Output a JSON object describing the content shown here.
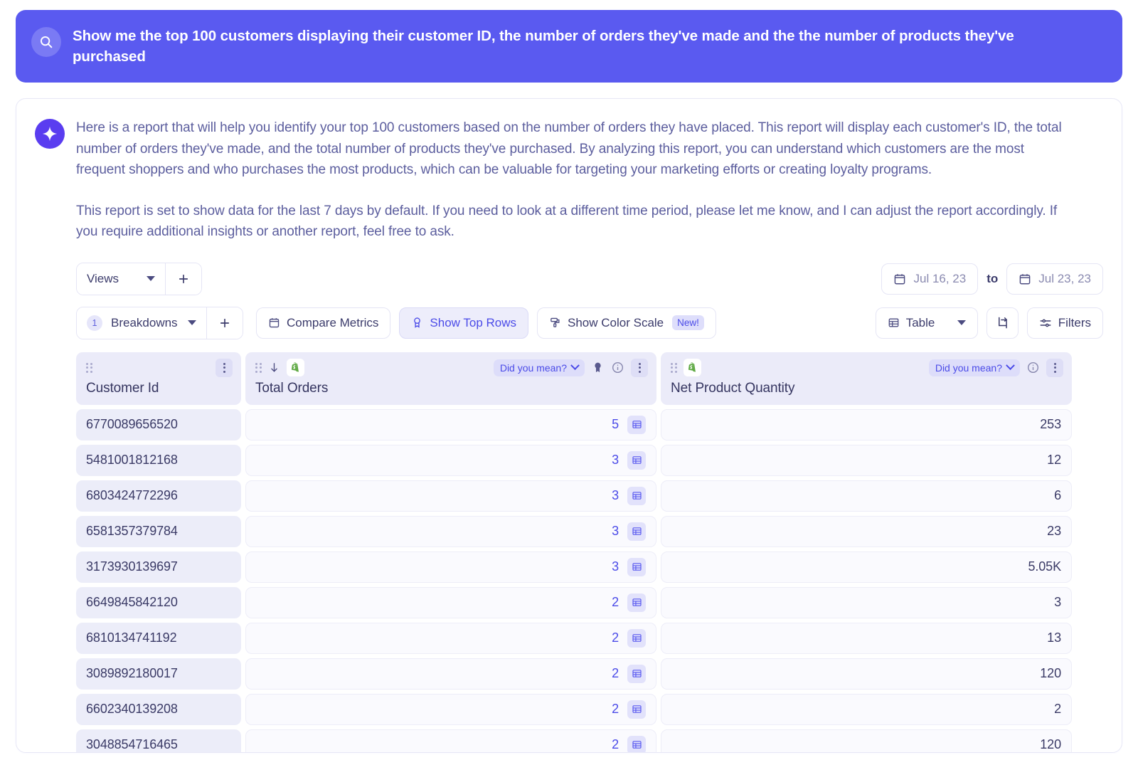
{
  "query": {
    "icon": "search-icon",
    "text": "Show me the top 100 customers displaying their customer ID, the number of orders they've made and the the number of products they've purchased"
  },
  "answer": {
    "icon": "sparkle-icon",
    "paragraph1": "Here is a report that will help you identify your top 100 customers based on the number of orders they have placed. This report will display each customer's ID, the total number of orders they've made, and the total number of products they've purchased. By analyzing this report, you can understand which customers are the most frequent shoppers and who purchases the most products, which can be valuable for targeting your marketing efforts or creating loyalty programs.",
    "paragraph2": "This report is set to show data for the last 7 days by default. If you need to look at a different time period, please let me know, and I can adjust the report accordingly. If you require additional insights or another report, feel free to ask."
  },
  "toolbar": {
    "views_label": "Views",
    "views_add_label": "+",
    "breakdowns_label": "Breakdowns",
    "breakdowns_count": "1",
    "breakdowns_add_label": "+",
    "compare_metrics_label": "Compare Metrics",
    "show_top_rows_label": "Show Top Rows",
    "show_color_scale_label": "Show Color Scale",
    "show_color_scale_badge": "New!",
    "table_label": "Table",
    "filters_label": "Filters",
    "date_from": "Jul 16, 23",
    "date_to_word": "to",
    "date_to": "Jul 23, 23"
  },
  "table": {
    "columns": [
      {
        "key": "customer_id",
        "title": "Customer Id",
        "source_icon": null,
        "sorted": false,
        "has_did_you_mean": false,
        "has_info": false,
        "has_kebab": true
      },
      {
        "key": "total_orders",
        "title": "Total Orders",
        "source_icon": "shopify-icon",
        "sorted": true,
        "sort_direction": "desc",
        "has_did_you_mean": true,
        "did_you_mean_label": "Did you mean?",
        "has_info": true,
        "has_kebab": true
      },
      {
        "key": "net_product_quantity",
        "title": "Net Product Quantity",
        "source_icon": "shopify-icon",
        "sorted": false,
        "has_did_you_mean": true,
        "did_you_mean_label": "Did you mean?",
        "has_info": true,
        "has_kebab": true
      }
    ],
    "rows": [
      {
        "customer_id": "6770089656520",
        "total_orders": "5",
        "net_product_quantity": "253"
      },
      {
        "customer_id": "5481001812168",
        "total_orders": "3",
        "net_product_quantity": "12"
      },
      {
        "customer_id": "6803424772296",
        "total_orders": "3",
        "net_product_quantity": "6"
      },
      {
        "customer_id": "6581357379784",
        "total_orders": "3",
        "net_product_quantity": "23"
      },
      {
        "customer_id": "3173930139697",
        "total_orders": "3",
        "net_product_quantity": "5.05K"
      },
      {
        "customer_id": "6649845842120",
        "total_orders": "2",
        "net_product_quantity": "3"
      },
      {
        "customer_id": "6810134741192",
        "total_orders": "2",
        "net_product_quantity": "13"
      },
      {
        "customer_id": "3089892180017",
        "total_orders": "2",
        "net_product_quantity": "120"
      },
      {
        "customer_id": "6602340139208",
        "total_orders": "2",
        "net_product_quantity": "2"
      },
      {
        "customer_id": "3048854716465",
        "total_orders": "2",
        "net_product_quantity": "120"
      }
    ]
  },
  "colors": {
    "brand_purple": "#5A5AF0",
    "accent_link": "#4B4BE8",
    "body_text": "#5C5E9E",
    "header_fill": "#EBEBF9",
    "id_cell_fill": "#ECEDF9",
    "metric_cell_fill": "#FAFAFE",
    "shopify_green": "#5FA944"
  }
}
